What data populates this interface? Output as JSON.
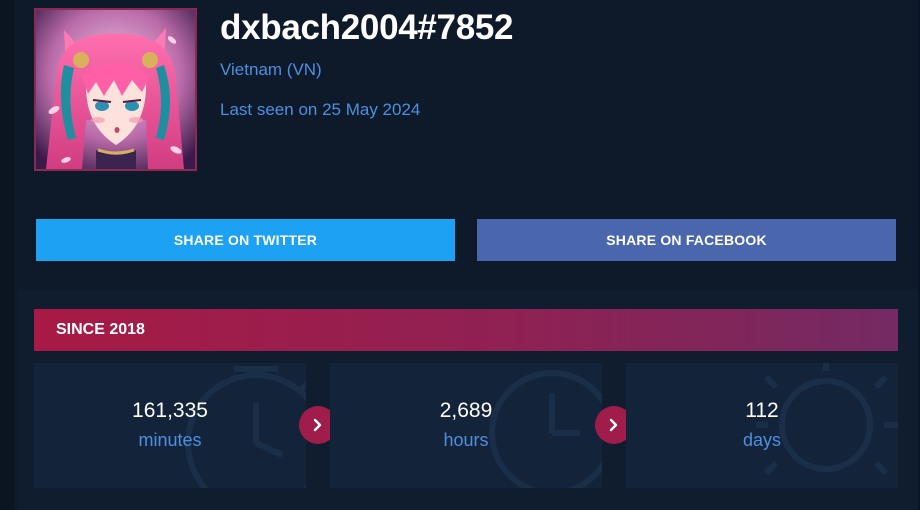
{
  "profile": {
    "username": "dxbach2004#7852",
    "region": "Vietnam (VN)",
    "last_seen": "Last seen on 25 May 2024",
    "avatar_icon": "champion-avatar-icon"
  },
  "share": {
    "twitter_label": "SHARE ON TWITTER",
    "facebook_label": "SHARE ON FACEBOOK",
    "twitter_color": "#1da1f2",
    "facebook_color": "#4a67ad"
  },
  "since": {
    "label": "SINCE 2018",
    "accent": "#a81a45"
  },
  "stats": [
    {
      "value": "161,335",
      "unit": "minutes",
      "icon": "stopwatch-icon"
    },
    {
      "value": "2,689",
      "unit": "hours",
      "icon": "clock-icon"
    },
    {
      "value": "112",
      "unit": "days",
      "icon": "sun-icon"
    }
  ],
  "arrows": [
    {
      "icon": "chevron-right-icon"
    },
    {
      "icon": "chevron-right-icon"
    }
  ]
}
